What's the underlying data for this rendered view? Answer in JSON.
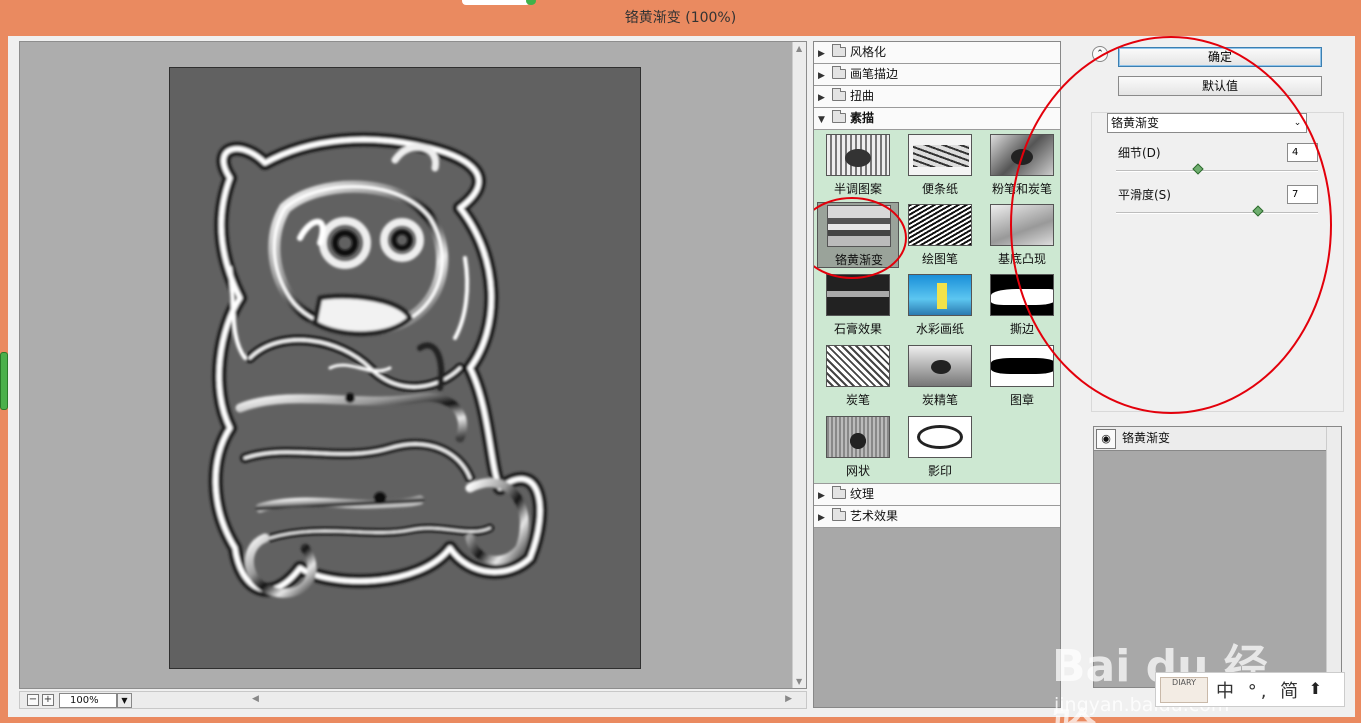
{
  "window": {
    "title": "铬黄渐变 (100%)"
  },
  "preview": {
    "zoom": "100%",
    "zoom_minus": "−",
    "zoom_plus": "+"
  },
  "filter_tree": {
    "categories_top": [
      {
        "label": "风格化",
        "expanded": false
      },
      {
        "label": "画笔描边",
        "expanded": false
      },
      {
        "label": "扭曲",
        "expanded": false
      }
    ],
    "open_category": "素描",
    "filters": [
      {
        "label": "半调图案"
      },
      {
        "label": "便条纸"
      },
      {
        "label": "粉笔和炭笔"
      },
      {
        "label": "铬黄渐变",
        "selected": true
      },
      {
        "label": "绘图笔"
      },
      {
        "label": "基底凸现"
      },
      {
        "label": "石膏效果"
      },
      {
        "label": "水彩画纸"
      },
      {
        "label": "撕边"
      },
      {
        "label": "炭笔"
      },
      {
        "label": "炭精笔"
      },
      {
        "label": "图章"
      },
      {
        "label": "网状"
      },
      {
        "label": "影印"
      }
    ],
    "categories_bottom": [
      {
        "label": "纹理",
        "expanded": false
      },
      {
        "label": "艺术效果",
        "expanded": false
      }
    ]
  },
  "controls": {
    "ok_label": "确定",
    "default_label": "默认值",
    "filter_select": "铬黄渐变",
    "params": [
      {
        "label": "细节(D)",
        "value": "4",
        "slider_fraction": 0.4
      },
      {
        "label": "平滑度(S)",
        "value": "7",
        "slider_fraction": 0.7
      }
    ]
  },
  "layers": {
    "items": [
      {
        "name": "铬黄渐变"
      }
    ]
  },
  "watermark": {
    "brand": "Bai du 经验",
    "url": "jingyan.baidu.com"
  },
  "ime": {
    "text": "中 °, 简",
    "logo": "DIARY"
  },
  "colors": {
    "title_bar": "#ea8a60",
    "thumb_area": "#cde8d2",
    "annotation_red": "#e3000b",
    "slider_thumb": "#6fae6f"
  }
}
